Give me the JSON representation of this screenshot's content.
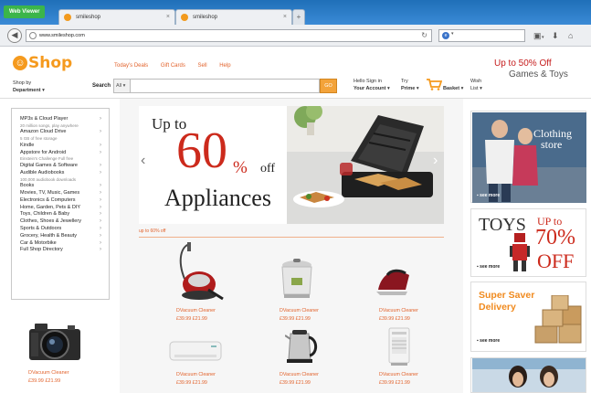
{
  "browser": {
    "badge": "Web Viewer",
    "tabs": [
      {
        "label": "smileshop",
        "close": "×"
      },
      {
        "label": "smileshop",
        "close": "×"
      }
    ],
    "new_tab": "+",
    "url": "www.smileshop.com",
    "engine_caret": "▾"
  },
  "site": {
    "logo_mark": "☺",
    "logo_text": "Shop",
    "top_links": [
      "Today's Deals",
      "Gift Cards",
      "Sell",
      "Help"
    ],
    "promo_top": {
      "line1": "Up to 50% Off",
      "line2": "Games & Toys"
    },
    "shop_by": {
      "line1": "Shop by",
      "line2": "Department"
    },
    "search": {
      "label": "Search",
      "category": "All",
      "placeholder": "",
      "go": "GO"
    },
    "account": {
      "line1": "Hello Sign in",
      "line2": "Your Account"
    },
    "prime": {
      "line1": "Try",
      "line2": "Prime"
    },
    "basket": "Basket",
    "wishlist": {
      "line1": "Wish",
      "line2": "List"
    }
  },
  "departments": [
    {
      "label": "MP3s & Cloud Player",
      "sub": "20 million songs, play anywhere"
    },
    {
      "label": "Amazon Cloud Drive",
      "sub": "5 GB of free storage"
    },
    {
      "label": "Kindle"
    },
    {
      "label": "Appstore for Android",
      "sub": "Einstein's Challenge Full free"
    },
    {
      "label": "Digital Games & Software"
    },
    {
      "label": "Audible Audiobooks",
      "sub": "100,000 audiobook downloads"
    },
    {
      "label": "Books"
    },
    {
      "label": "Movies, TV, Music, Games"
    },
    {
      "label": "Electronics & Computers"
    },
    {
      "label": "Home, Garden, Pets & DIY"
    },
    {
      "label": "Toys, Children & Baby"
    },
    {
      "label": "Clothes, Shoes & Jewellery"
    },
    {
      "label": "Sports & Outdoors"
    },
    {
      "label": "Grocery, Health & Beauty"
    },
    {
      "label": "Car & Motorbike"
    },
    {
      "label": "Full Shop Directory"
    }
  ],
  "hero": {
    "up_to": "Up to",
    "percent": "60",
    "pct_sign": "%",
    "off": "off",
    "category": "Appliances",
    "caption": "up to 60% off"
  },
  "products": [
    {
      "name": "DVacuum Cleaner",
      "price": "£39.99 £21.99"
    },
    {
      "name": "DVacuum Cleaner",
      "price": "£39.99 £21.99"
    },
    {
      "name": "DVacuum Cleaner",
      "price": "£39.99 £21.99"
    },
    {
      "name": "DVacuum Cleaner",
      "price": "£39.99 £21.99"
    },
    {
      "name": "DVacuum Cleaner",
      "price": "£39.99 £21.99"
    },
    {
      "name": "DVacuum Cleaner",
      "price": "£39.99 £21.99"
    },
    {
      "name": "DVacuum Cleaner",
      "price": "£39.99 £21.99"
    }
  ],
  "side_promos": {
    "clothing": {
      "title1": "Clothing",
      "title2": "store",
      "see_more": "see more"
    },
    "toys": {
      "title": "TOYS",
      "up_to": "UP to",
      "pct": "70%",
      "off": "OFF",
      "see_more": "see more"
    },
    "saver": {
      "title1": "Super Saver",
      "title2": "Delivery",
      "see_more": "see more"
    }
  },
  "colors": {
    "accent": "#f59a1e",
    "link": "#e2622b",
    "sale_red": "#cc2a1c"
  }
}
